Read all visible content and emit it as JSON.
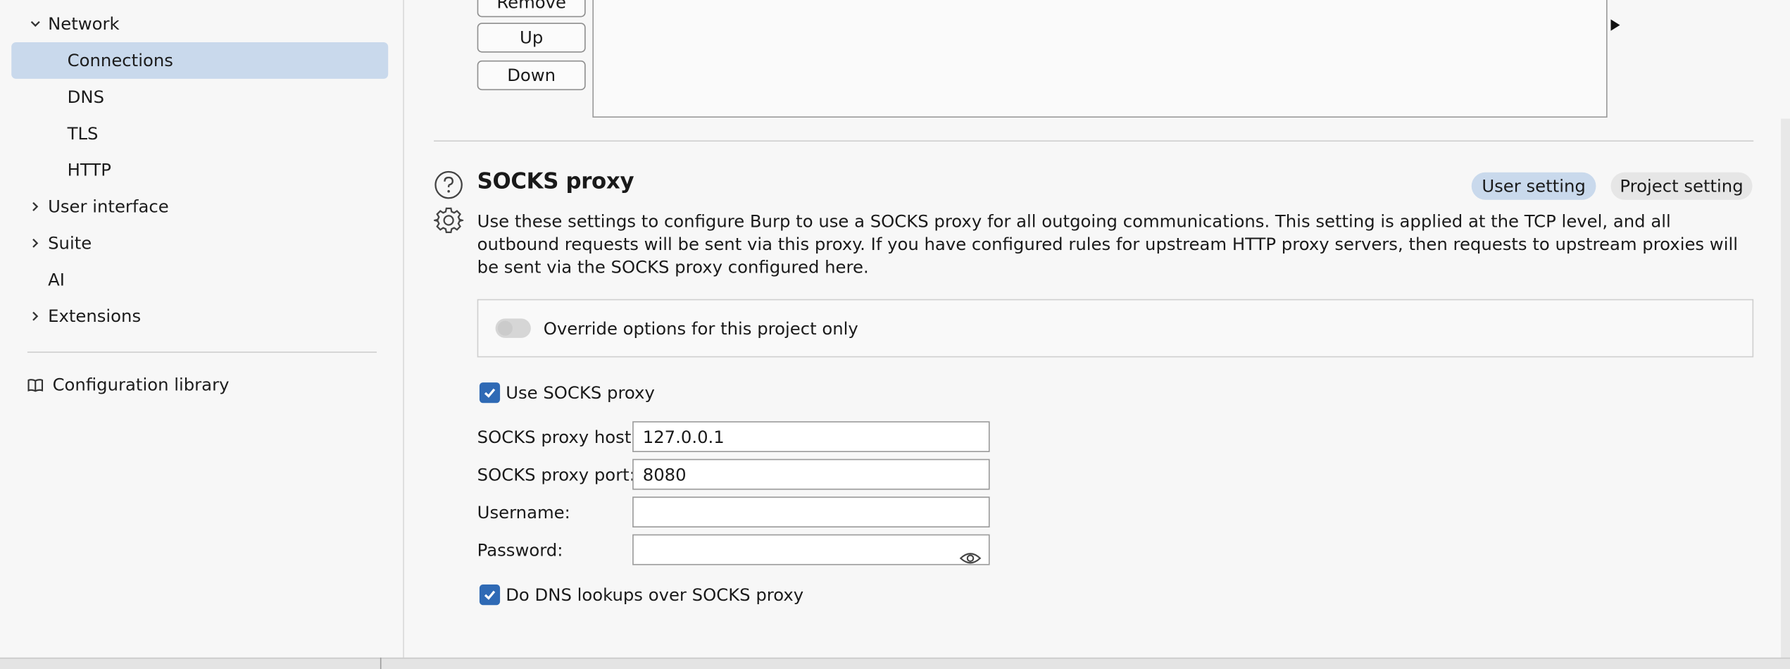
{
  "sidebar": {
    "network_label": "Network",
    "connections_label": "Connections",
    "dns_label": "DNS",
    "tls_label": "TLS",
    "http_label": "HTTP",
    "user_interface_label": "User interface",
    "suite_label": "Suite",
    "ai_label": "AI",
    "extensions_label": "Extensions",
    "config_library_label": "Configuration library"
  },
  "list_buttons": {
    "remove": "Remove",
    "up": "Up",
    "down": "Down"
  },
  "socks": {
    "title": "SOCKS proxy",
    "user_setting": "User setting",
    "project_setting": "Project setting",
    "description": "Use these settings to configure Burp to use a SOCKS proxy for all outgoing communications. This setting is applied at the TCP level, and all outbound requests will be sent via this proxy. If you have configured rules for upstream HTTP proxy servers, then requests to upstream proxies will be sent via the SOCKS proxy configured here.",
    "override_label": "Override options for this project only",
    "override_enabled": false,
    "use_socks_label": "Use SOCKS proxy",
    "use_socks_checked": true,
    "host_label": "SOCKS proxy host:",
    "host_value": "127.0.0.1",
    "port_label": "SOCKS proxy port:",
    "port_value": "8080",
    "username_label": "Username:",
    "username_value": "",
    "password_label": "Password:",
    "password_value": "",
    "dns_label": "Do DNS lookups over SOCKS proxy",
    "dns_checked": true
  },
  "colors": {
    "selected_bg": "#c9d9ec",
    "accent": "#2f6ab5",
    "user_pill_bg": "#c9d9ec",
    "project_pill_bg": "#e6e6e6"
  }
}
